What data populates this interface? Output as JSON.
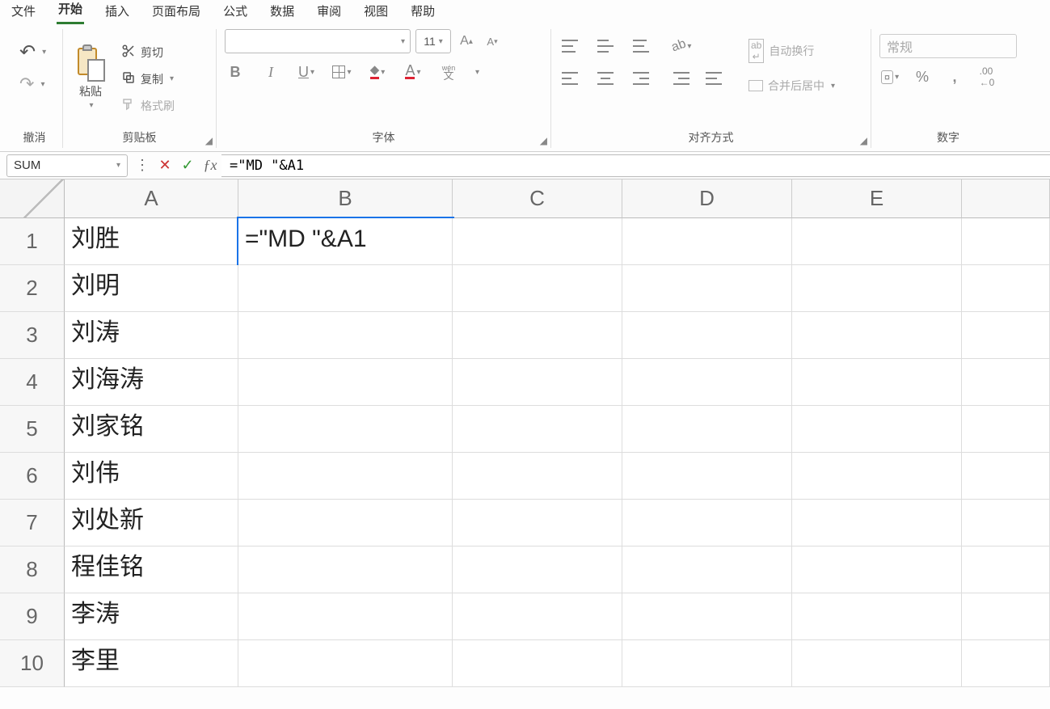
{
  "menu": {
    "items": [
      "文件",
      "开始",
      "插入",
      "页面布局",
      "公式",
      "数据",
      "审阅",
      "视图",
      "帮助"
    ],
    "active_index": 1
  },
  "ribbon": {
    "undo": {
      "label": "撤消"
    },
    "clipboard": {
      "label": "剪贴板",
      "paste": "粘贴",
      "cut": "剪切",
      "copy": "复制",
      "format_painter": "格式刷"
    },
    "font": {
      "label": "字体",
      "size": "11",
      "wenzi": "wén",
      "wenzi2": "文"
    },
    "align": {
      "label": "对齐方式",
      "wrap": "自动换行",
      "merge": "合并后居中"
    },
    "number": {
      "label": "数字",
      "format": "常规"
    }
  },
  "formula_bar": {
    "name_box": "SUM",
    "formula": "=\"MD \"&A1"
  },
  "sheet": {
    "columns": [
      "A",
      "B",
      "C",
      "D",
      "E"
    ],
    "rows": [
      {
        "n": "1",
        "A": "刘胜",
        "B": "=\"MD \"&A1"
      },
      {
        "n": "2",
        "A": "刘明"
      },
      {
        "n": "3",
        "A": "刘涛"
      },
      {
        "n": "4",
        "A": "刘海涛"
      },
      {
        "n": "5",
        "A": "刘家铭"
      },
      {
        "n": "6",
        "A": "刘伟"
      },
      {
        "n": "7",
        "A": "刘处新"
      },
      {
        "n": "8",
        "A": "程佳铭"
      },
      {
        "n": "9",
        "A": "李涛"
      },
      {
        "n": "10",
        "A": "李里"
      }
    ],
    "editing": {
      "row": 0,
      "col": "B"
    }
  }
}
